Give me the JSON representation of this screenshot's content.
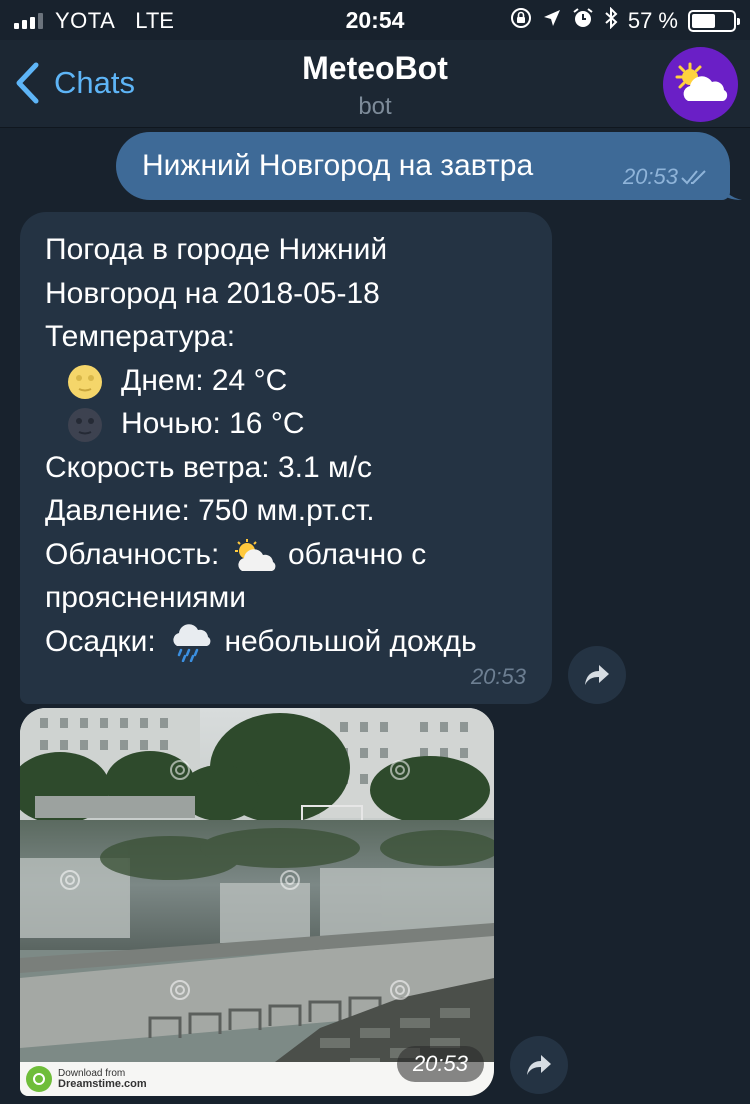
{
  "status_bar": {
    "carrier": "YOTA",
    "network": "LTE",
    "time": "20:54",
    "battery": "57 %",
    "battery_level": 0.57
  },
  "header": {
    "back_label": "Chats",
    "title": "MeteoBot",
    "subtitle": "bot"
  },
  "messages": {
    "outgoing": {
      "text": "Нижний Новгород на завтра",
      "time": "20:53"
    },
    "forecast": {
      "line1": "Погода в городе Нижний",
      "line2": "Новгород на 2018-05-18",
      "line3": "Температура:",
      "day": "Днем: 24 °C",
      "night": "Ночью: 16 °C",
      "wind": "Скорость ветра: 3.1 м/с",
      "pressure": "Давление: 750 мм.рт.ст.",
      "cloud_label": "Облачность:",
      "cloud_value": "облачно с",
      "cloud_value2": "прояснениями",
      "precip_label": "Осадки:",
      "precip_value": "небольшой дождь",
      "time": "20:53"
    },
    "photo": {
      "time": "20:53",
      "watermark_line1": "Download from",
      "watermark_line2": "Dreamstime.com"
    }
  },
  "colors": {
    "background": "#18222d",
    "header": "#1c2733",
    "accent": "#5eb5f7",
    "outgoing_bubble": "#3e6a97",
    "incoming_bubble": "#243343",
    "avatar": "#6a1fc6"
  },
  "icons": [
    "back-chevron-icon",
    "cloud-sun-icon",
    "full-moon-face-icon",
    "new-moon-face-icon",
    "rain-cloud-icon",
    "share-icon",
    "double-check-icon"
  ]
}
